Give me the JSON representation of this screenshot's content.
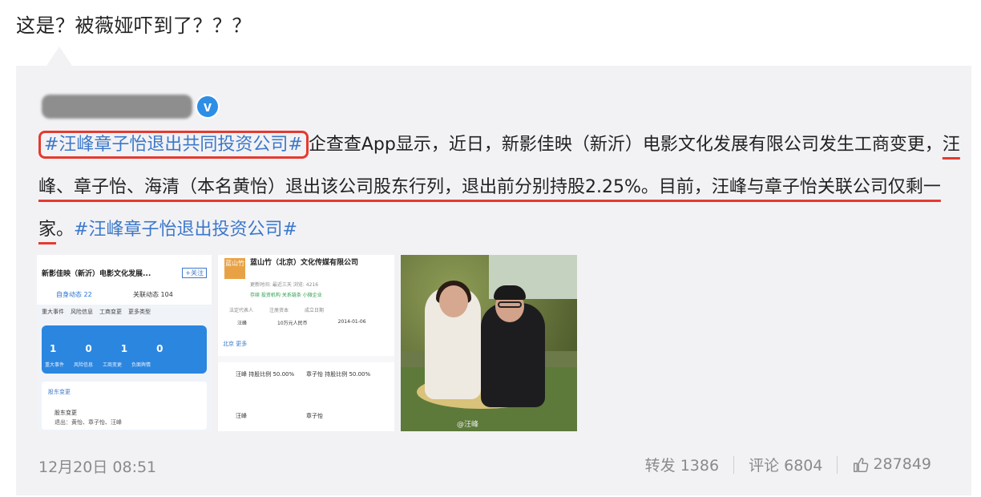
{
  "post": {
    "text": "这是？被薇娅吓到了？？？"
  },
  "repost": {
    "author_verified_icon": "v",
    "content": {
      "hashtag1": "#汪峰章子怡退出共同投资公司#",
      "part1": "企查查App显示，近日，新影佳映（新沂）电影文化发展有限公司发生工商变更，",
      "underlined": "汪峰、章子怡、海清（本名黄怡）退出该公司股东行列，退出前分别持股2.25%。目前，汪峰与章子怡关联公司仅剩一家",
      "part2": "。",
      "hashtag2": "#汪峰章子怡退出投资公司#"
    },
    "images": {
      "img1": {
        "title": "新影佳映（新沂）电影文化发展...",
        "tag": "+关注",
        "tab1": "自身动态 22",
        "tab2": "关联动态 104",
        "chips": [
          "重大事件",
          "风险信息",
          "工商变更",
          "更多类型"
        ],
        "nums": [
          "1",
          "0",
          "1",
          "0"
        ],
        "labels": [
          "重大事件",
          "风险信息",
          "工商变更",
          "负面舆情"
        ],
        "change_title": "股东变更",
        "change_text": "退出：黄怡、章子怡、汪峰",
        "change_tag": "股东变更"
      },
      "img2": {
        "logo": "蓝山竹",
        "name": "蓝山竹（北京）文化传媒有限公司",
        "meta": "更新时间: 最近三天   浏览: 4216",
        "status": "存续  投资机构  关系链条  小微企业",
        "cols": [
          "法定代表人",
          "注册资本",
          "成立日期"
        ],
        "vals": [
          "汪峰",
          "10万元人民币",
          "2014-01-06"
        ],
        "loc": "北京  更多",
        "p1": "汪峰 持股比例 50.00%",
        "p2": "章子怡 持股比例 50.00%",
        "p3": "汪峰",
        "p4": "章子怡"
      },
      "img3": {
        "watermark": "@汪峰"
      }
    },
    "time": "12月20日 08:51",
    "actions": {
      "forward": "转发 1386",
      "comment": "评论 6804",
      "like": "287849"
    }
  }
}
